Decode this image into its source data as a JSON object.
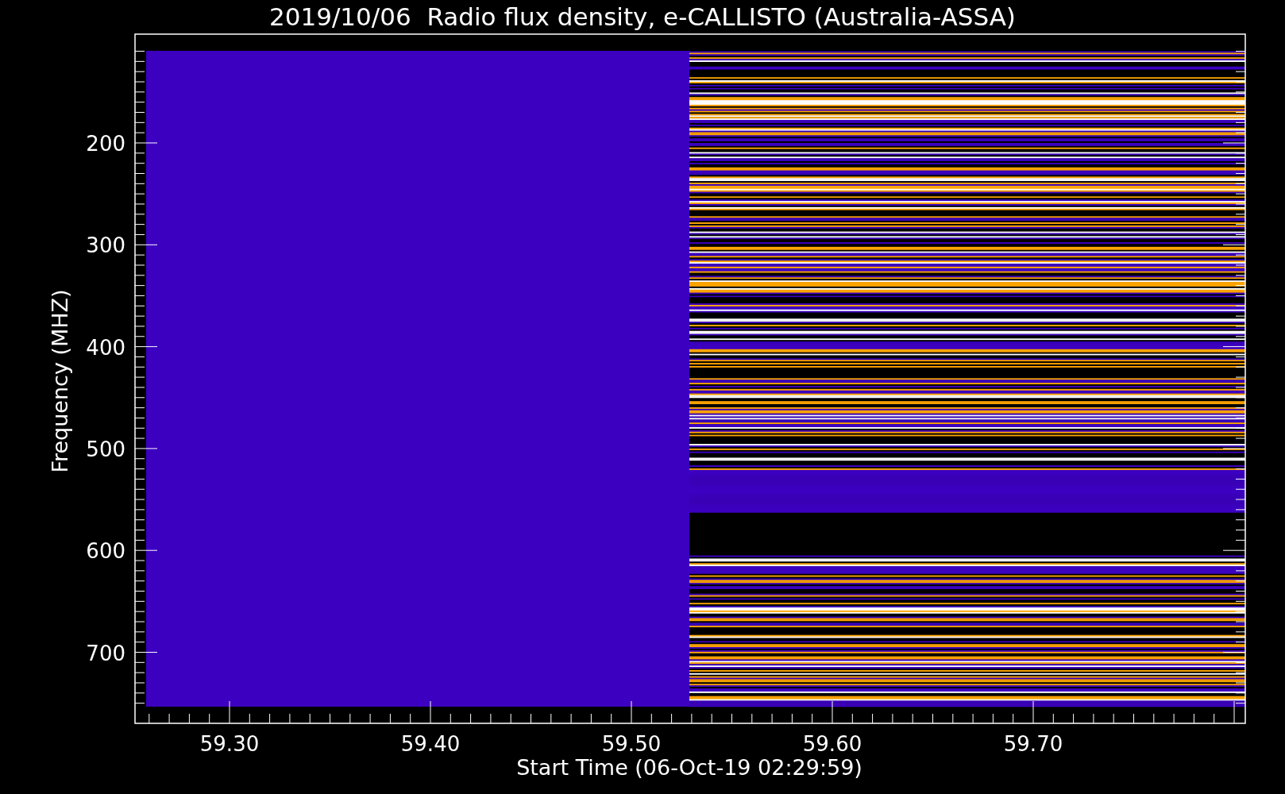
{
  "title": "2019/10/06  Radio flux density, e-CALLISTO (Australia-ASSA)",
  "ylabel": "Frequency (MHZ)",
  "xlabel": "Start Time (06-Oct-19 02:29:59)",
  "yticks": [
    "200",
    "300",
    "400",
    "500",
    "600",
    "700"
  ],
  "xticks": [
    "59.30",
    "59.40",
    "59.50",
    "59.60",
    "59.70"
  ]
}
